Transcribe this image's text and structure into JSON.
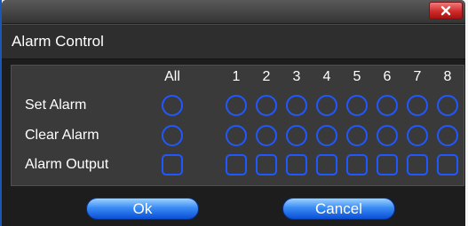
{
  "window": {
    "title": "Alarm Control",
    "close_icon": "x-icon",
    "colors": {
      "background": "#1d1d1d",
      "panel": "#3a3a3a",
      "control_blue": "#2058ff",
      "close_red": "#d12a2a"
    }
  },
  "grid": {
    "columns": [
      "All",
      "1",
      "2",
      "3",
      "4",
      "5",
      "6",
      "7",
      "8"
    ],
    "rows": [
      {
        "label": "Set Alarm",
        "control": "circle"
      },
      {
        "label": "Clear Alarm",
        "control": "circle"
      },
      {
        "label": "Alarm Output",
        "control": "square"
      }
    ]
  },
  "buttons": {
    "ok": "Ok",
    "cancel": "Cancel"
  }
}
